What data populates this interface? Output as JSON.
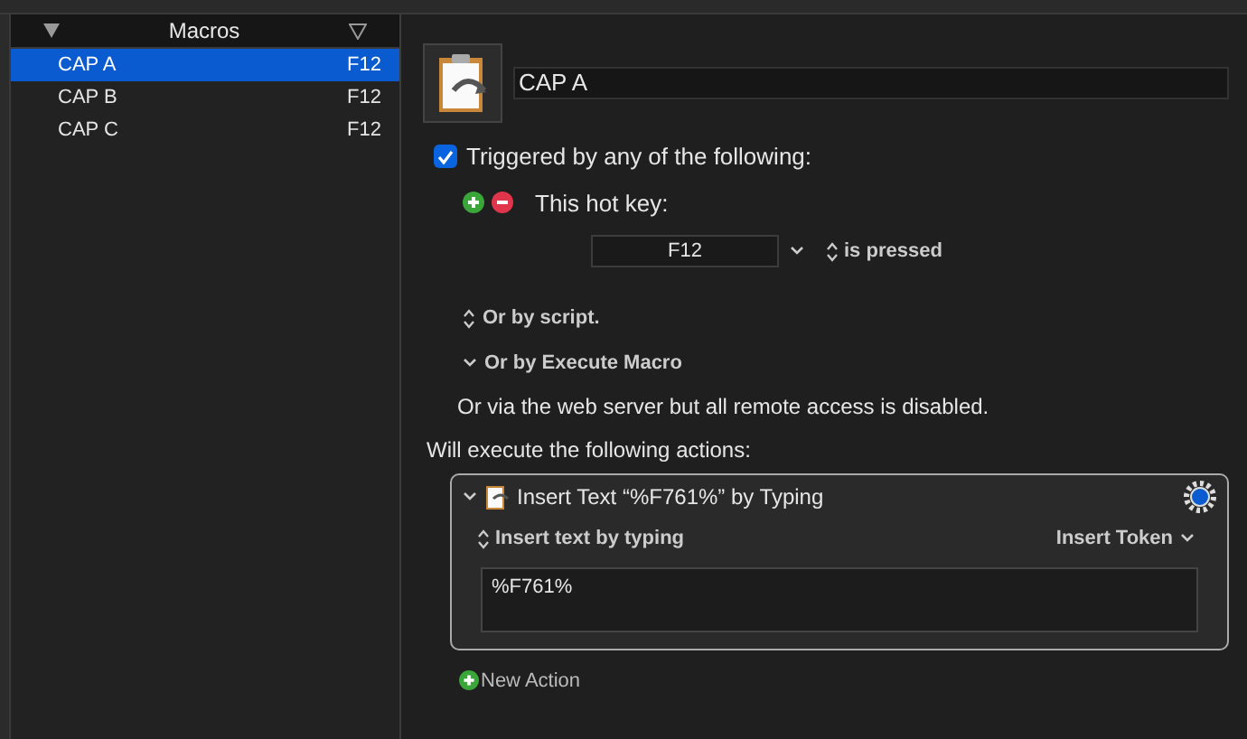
{
  "macros_list": {
    "title": "Macros",
    "items": [
      {
        "name": "CAP A",
        "hotkey": "F12",
        "selected": true
      },
      {
        "name": "CAP B",
        "hotkey": "F12",
        "selected": false
      },
      {
        "name": "CAP C",
        "hotkey": "F12",
        "selected": false
      }
    ]
  },
  "editor": {
    "macro_name": "CAP A",
    "trigger": {
      "label": "Triggered by any of the following:",
      "checked": true
    },
    "hotkey_label": "This hot key:",
    "hotkey_value": "F12",
    "hotkey_condition": "is pressed",
    "or_script": "Or by script.",
    "or_execute_macro": "Or by Execute Macro",
    "web_server_note": "Or via the web server but all remote access is disabled.",
    "actions_heading": "Will execute the following actions:",
    "actions": [
      {
        "title": "Insert Text “%F761%” by Typing",
        "mode": "Insert text by typing",
        "token_menu": "Insert Token",
        "text": "%F761%",
        "expanded": true
      }
    ],
    "new_action": "New Action"
  }
}
